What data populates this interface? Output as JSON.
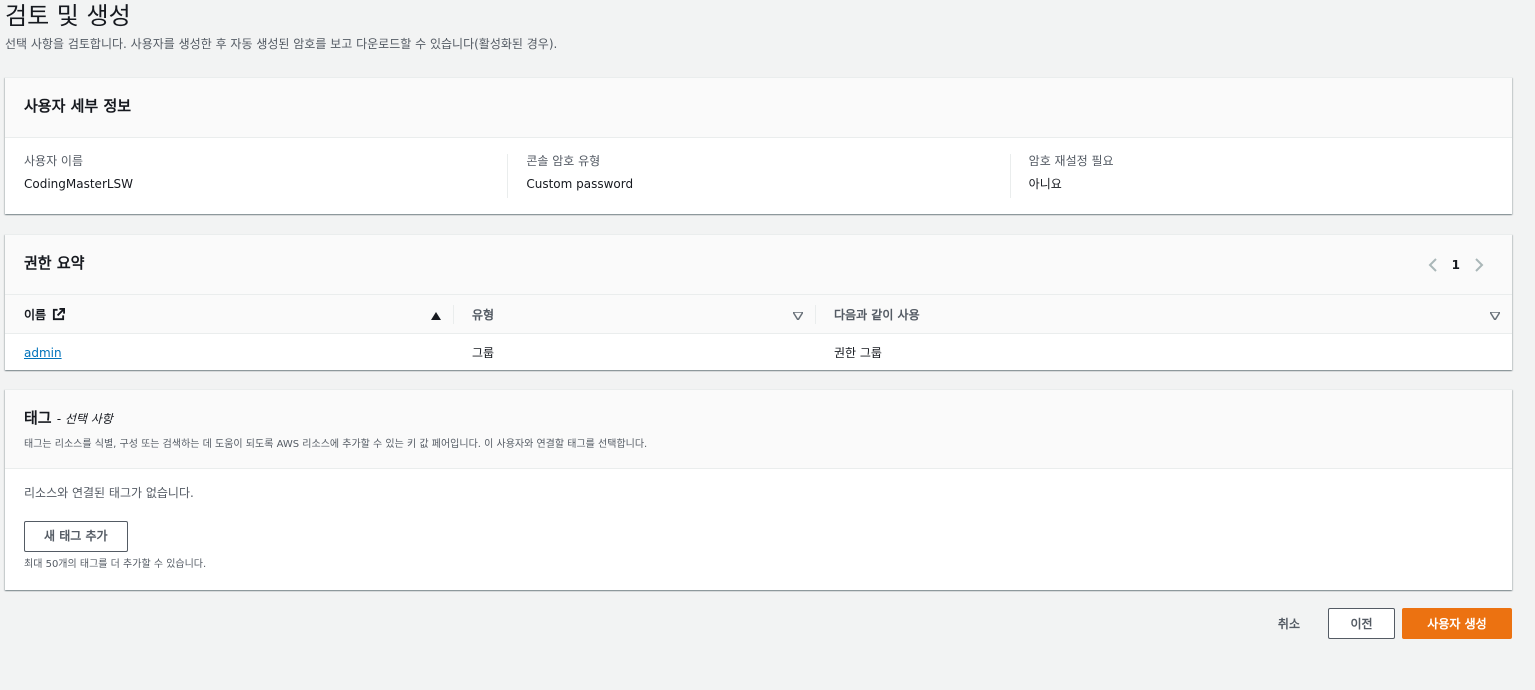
{
  "page": {
    "title": "검토 및 생성",
    "description": "선택 사항을 검토합니다. 사용자를 생성한 후 자동 생성된 암호를 보고 다운로드할 수 있습니다(활성화된 경우)."
  },
  "user_details": {
    "title": "사용자 세부 정보",
    "fields": [
      {
        "label": "사용자 이름",
        "value": "CodingMasterLSW"
      },
      {
        "label": "콘솔 암호 유형",
        "value": "Custom password"
      },
      {
        "label": "암호 재설정 필요",
        "value": "아니요"
      }
    ]
  },
  "permissions": {
    "title": "권한 요약",
    "page_number": "1",
    "columns": [
      "이름",
      "유형",
      "다음과 같이 사용"
    ],
    "rows": [
      {
        "name": "admin",
        "type": "그룹",
        "used_as": "권한 그룹"
      }
    ]
  },
  "tags": {
    "title": "태그",
    "optional_suffix": "- 선택 사항",
    "description": "태그는 리소스를 식별, 구성 또는 검색하는 데 도움이 되도록 AWS 리소스에 추가할 수 있는 키 값 페어입니다. 이 사용자와 연결할 태그를 선택합니다.",
    "empty_message": "리소스와 연결된 태그가 없습니다.",
    "add_button": "새 태그 추가",
    "limit_note": "최대 50개의 태그를 더 추가할 수 있습니다."
  },
  "actions": {
    "cancel": "취소",
    "previous": "이전",
    "create": "사용자 생성"
  },
  "colors": {
    "primary": "#ec7211",
    "link": "#0073bb",
    "background": "#f2f3f3"
  }
}
